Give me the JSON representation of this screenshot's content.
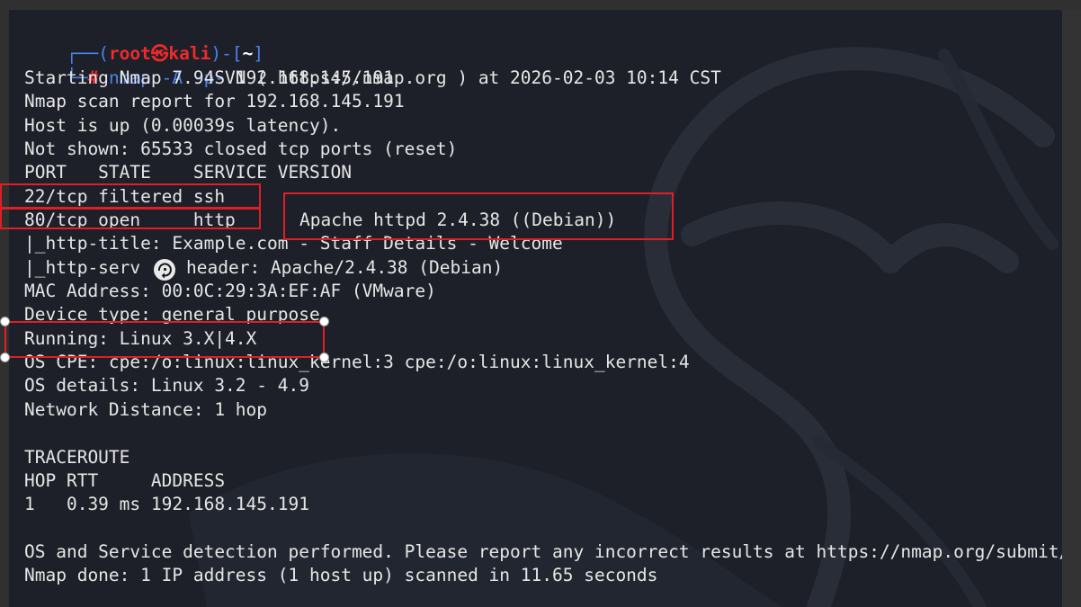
{
  "prompt": {
    "open": "┌──(",
    "user": "root",
    "at_symbol": "㉿",
    "host": "kali",
    "mid": ")-[",
    "path": "~",
    "close": "]",
    "second_corner": "└─",
    "hash": "#",
    "command": "nmap",
    "args": "-A -p-",
    "target": "192.168.145.191"
  },
  "output": {
    "start": "Starting Nmap 7.94SVN ( https://nmap.org ) at 2026-02-03 10:14 CST",
    "report": "Nmap scan report for 192.168.145.191",
    "host_up": "Host is up (0.00039s latency).",
    "not_shown": "Not shown: 65533 closed tcp ports (reset)",
    "port_header": "PORT   STATE    SERVICE VERSION",
    "port_22": "22/tcp filtered ssh",
    "port_80": "80/tcp open     http",
    "port_80_version": "Apache httpd 2.4.38 ((Debian))",
    "http_title": "|_http-title: Example.com - Staff Details - Welcome",
    "http_server_prefix": "|_http-serv",
    "http_server_suffix": "header: Apache/2.4.38 (Debian)",
    "mac": "MAC Address: 00:0C:29:3A:EF:AF (VMware)",
    "device_type": "Device type: general purpose",
    "running": "Running: Linux 3.X|4.X",
    "os_cpe": "OS CPE: cpe:/o:linux:linux_kernel:3 cpe:/o:linux:linux_kernel:4",
    "os_details": "OS details: Linux 3.2 - 4.9",
    "network_distance": "Network Distance: 1 hop",
    "traceroute": "TRACEROUTE",
    "trace_header": "HOP RTT     ADDRESS",
    "trace_row": "1   0.39 ms 192.168.145.191",
    "detection_note": "OS and Service detection performed. Please report any incorrect results at https://nmap.org/submit/ .",
    "done": "Nmap done: 1 IP address (1 host up) scanned in 11.65 seconds"
  },
  "annotations": {
    "box_color": "#e01f25",
    "selected_box_label": "Running: Linux 3.X|4.X"
  },
  "colors": {
    "terminal_bg": "#1d2029",
    "text": "#e6e6e6",
    "prompt_blue": "#4a83ec",
    "prompt_red": "#ee2b2b",
    "frame": "#303030"
  },
  "icons": {
    "cursor": "rotate-cursor-icon",
    "background": "kali-dragon-logo"
  }
}
